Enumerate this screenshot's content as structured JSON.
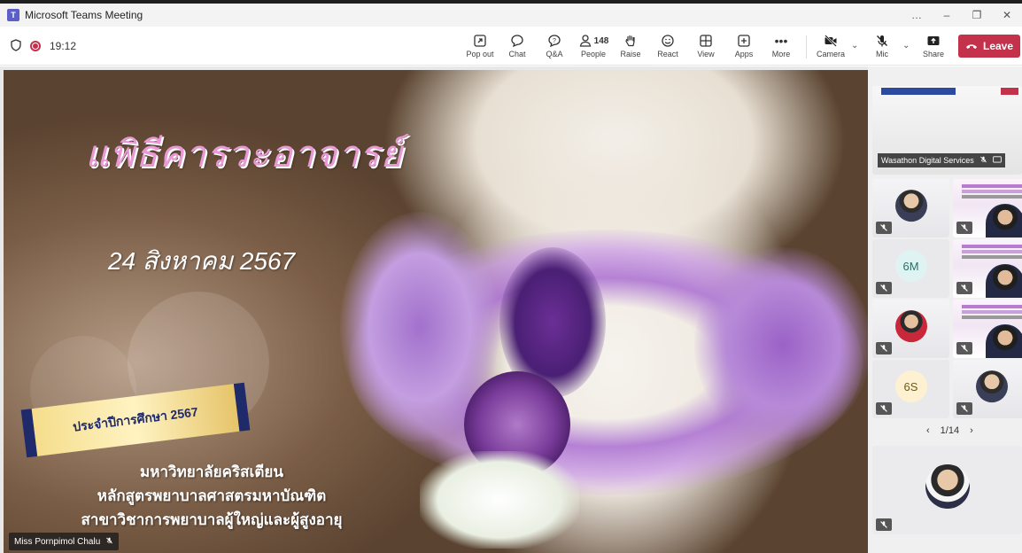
{
  "window": {
    "title": "Microsoft Teams Meeting",
    "controls": [
      "…",
      "–",
      "❐",
      "✕"
    ]
  },
  "toolbar": {
    "timer": "19:12",
    "buttons": {
      "popout": "Pop out",
      "chat": "Chat",
      "qa": "Q&A",
      "people": "People",
      "raise": "Raise",
      "react": "React",
      "view": "View",
      "apps": "Apps",
      "more": "More",
      "camera": "Camera",
      "mic": "Mic",
      "share": "Share"
    },
    "people_count": "148",
    "leave": "Leave"
  },
  "slide": {
    "title": "แพิธีคารวะอาจารย์",
    "date": "24 สิงหาคม 2567",
    "ribbon": "ประจำปีการศึกษา 2567",
    "lines": [
      "มหาวิทยาลัยคริสเตียน",
      "หลักสูตรพยาบาลศาสตรมหาบัณฑิต",
      "สาขาวิชาการพยาบาลผู้ใหญ่และผู้สูงอายุ"
    ],
    "presenter": "Miss Pornpimol Chalu"
  },
  "sidebar": {
    "shared_name": "Wasathon Digital Services",
    "tiles": [
      {
        "initials": ""
      },
      {
        "initials": ""
      },
      {
        "initials": "6M"
      },
      {
        "initials": ""
      },
      {
        "initials": ""
      },
      {
        "initials": ""
      },
      {
        "initials": "6S"
      },
      {
        "initials": ""
      }
    ],
    "pager": "1/14"
  },
  "colors": {
    "leave": "#c4314b",
    "teams_purple": "#5b5fc7",
    "title_pink": "#e89ad6"
  }
}
